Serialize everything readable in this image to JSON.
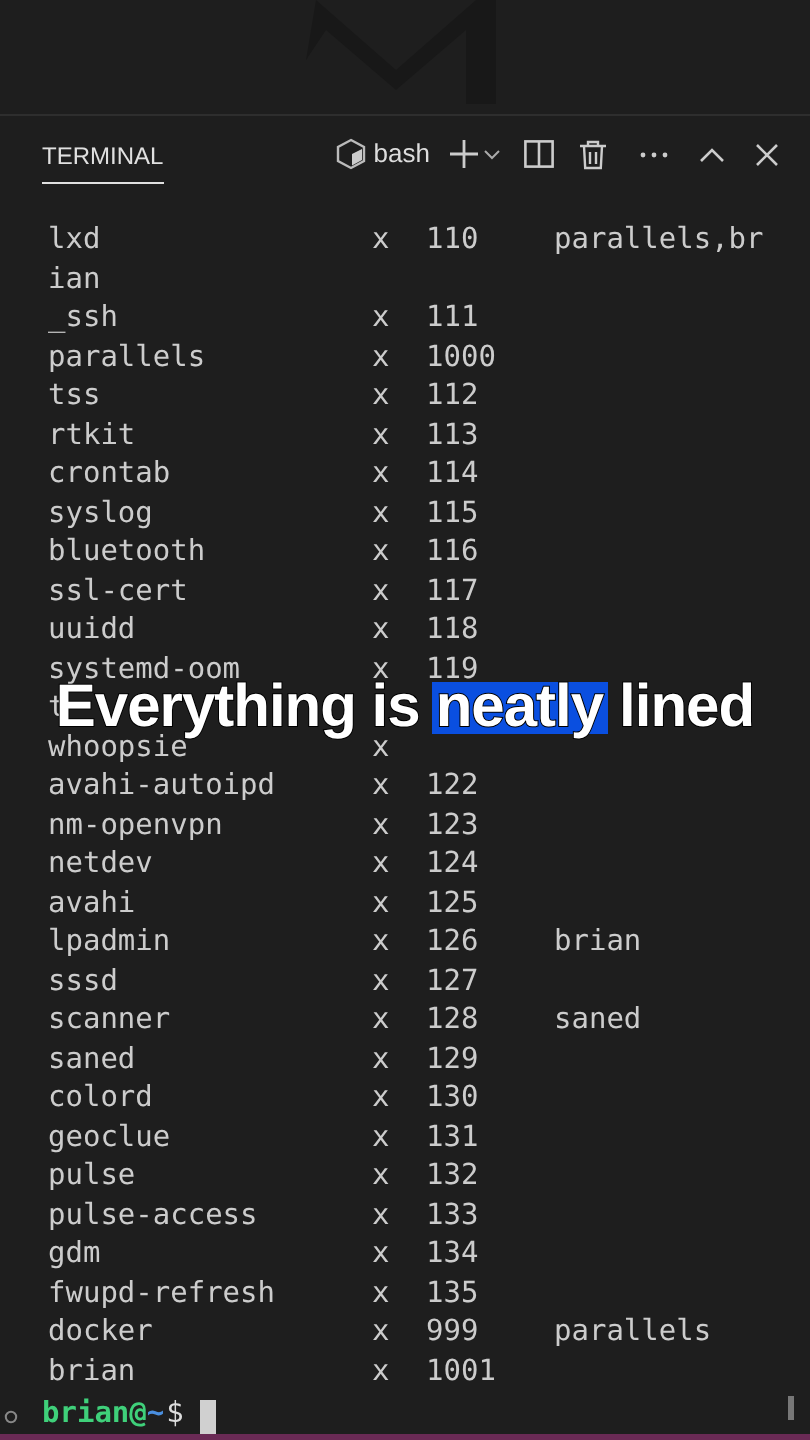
{
  "panel": {
    "tab": {
      "label": "TERMINAL",
      "selected": true
    },
    "shell": {
      "label": "bash"
    }
  },
  "rows": [
    {
      "name": "lxd",
      "mark": "x",
      "id": "110",
      "groups": "parallels,br"
    },
    {
      "name": "ian"
    },
    {
      "name": "_ssh",
      "mark": "x",
      "id": "111"
    },
    {
      "name": "parallels",
      "mark": "x",
      "id": "1000"
    },
    {
      "name": "tss",
      "mark": "x",
      "id": "112"
    },
    {
      "name": "rtkit",
      "mark": "x",
      "id": "113"
    },
    {
      "name": "crontab",
      "mark": "x",
      "id": "114"
    },
    {
      "name": "syslog",
      "mark": "x",
      "id": "115"
    },
    {
      "name": "bluetooth",
      "mark": "x",
      "id": "116"
    },
    {
      "name": "ssl-cert",
      "mark": "x",
      "id": "117"
    },
    {
      "name": "uuidd",
      "mark": "x",
      "id": "118"
    },
    {
      "name": "systemd-oom",
      "mark": "x",
      "id": "119"
    },
    {
      "name": "t"
    },
    {
      "name": "whoopsie",
      "mark": "x"
    },
    {
      "name": "avahi-autoipd",
      "mark": "x",
      "id": "122"
    },
    {
      "name": "nm-openvpn",
      "mark": "x",
      "id": "123"
    },
    {
      "name": "netdev",
      "mark": "x",
      "id": "124"
    },
    {
      "name": "avahi",
      "mark": "x",
      "id": "125"
    },
    {
      "name": "lpadmin",
      "mark": "x",
      "id": "126",
      "groups": "brian"
    },
    {
      "name": "sssd",
      "mark": "x",
      "id": "127"
    },
    {
      "name": "scanner",
      "mark": "x",
      "id": "128",
      "groups": "saned"
    },
    {
      "name": "saned",
      "mark": "x",
      "id": "129"
    },
    {
      "name": "colord",
      "mark": "x",
      "id": "130"
    },
    {
      "name": "geoclue",
      "mark": "x",
      "id": "131"
    },
    {
      "name": "pulse",
      "mark": "x",
      "id": "132"
    },
    {
      "name": "pulse-access",
      "mark": "x",
      "id": "133"
    },
    {
      "name": "gdm",
      "mark": "x",
      "id": "134"
    },
    {
      "name": "fwupd-refresh",
      "mark": "x",
      "id": "135"
    },
    {
      "name": "docker",
      "mark": "x",
      "id": "999",
      "groups": "parallels"
    },
    {
      "name": "brian",
      "mark": "x",
      "id": "1001"
    }
  ],
  "prompt": {
    "user": "brian@",
    "path": "~",
    "symbol": "$"
  },
  "caption": [
    {
      "text": "Everything is",
      "highlighted": false
    },
    {
      "text": "neatly",
      "highlighted": true
    },
    {
      "text": "lined",
      "highlighted": false
    }
  ]
}
